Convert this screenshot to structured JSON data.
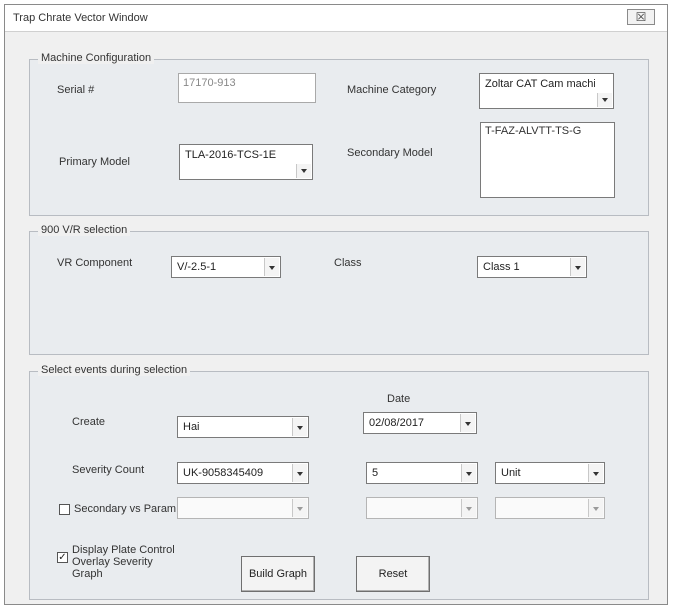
{
  "window": {
    "title": "Trap Chrate Vector Window",
    "close_label": "☒"
  },
  "machine_config": {
    "caption": "Machine Configuration",
    "serial_label": "Serial #",
    "serial_value": "17170-913",
    "category_label": "Machine Category",
    "category_value": "Zoltar CAT Cam machine",
    "primary_model_label": "Primary Model",
    "primary_model_value": "TLA-2016-TCS-1E",
    "secondary_model_label": "Secondary Model",
    "secondary_model_value": "T-FAZ-ALVTT-TS-G"
  },
  "vts": {
    "caption": "900 V/R selection",
    "component_label": "VR Component",
    "component_value": "V/-2.5-1",
    "class_label": "Class",
    "class_value": "Class 1"
  },
  "event_date": {
    "caption": "Select events during selection",
    "date_header": "Date",
    "create_label": "Create",
    "create_value": "Hai",
    "date_value": "02/08/2017",
    "severity_label": "Severity Count",
    "severity_value": "UK-9058345409",
    "severity_num": "5",
    "severity_unit": "Unit",
    "secondary_label": "Secondary vs Param",
    "secondary_value": "",
    "secondary_num": "",
    "secondary_unit": "",
    "option_label": "Display Plate Control Overlay Severity Graph",
    "option_checked": "✓"
  },
  "buttons": {
    "build": "Build Graph",
    "reset": "Reset"
  }
}
